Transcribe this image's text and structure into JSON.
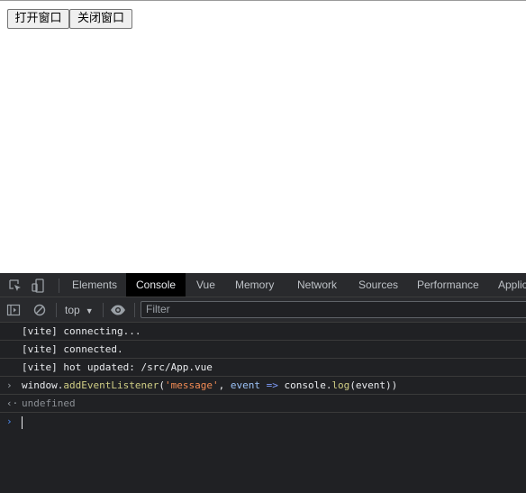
{
  "page": {
    "open_window_button": "打开窗口",
    "close_window_button": "关闭窗口"
  },
  "devtools": {
    "tabs": [
      "Elements",
      "Console",
      "Vue",
      "Memory",
      "Network",
      "Sources",
      "Performance",
      "Applic"
    ],
    "active_tab": "Console",
    "context": "top",
    "filter_placeholder": "Filter",
    "messages": [
      "[vite] connecting...",
      "[vite] connected.",
      "[vite] hot updated: /src/App.vue"
    ],
    "command": {
      "window": "window",
      "dot1": ".",
      "method": "addEventListener",
      "open_paren": "(",
      "string": "'message'",
      "comma": ", ",
      "param": "event",
      "arrow": " => ",
      "console": "console",
      "dot2": ".",
      "log": "log",
      "close_part": "(event))"
    },
    "result": "undefined"
  }
}
